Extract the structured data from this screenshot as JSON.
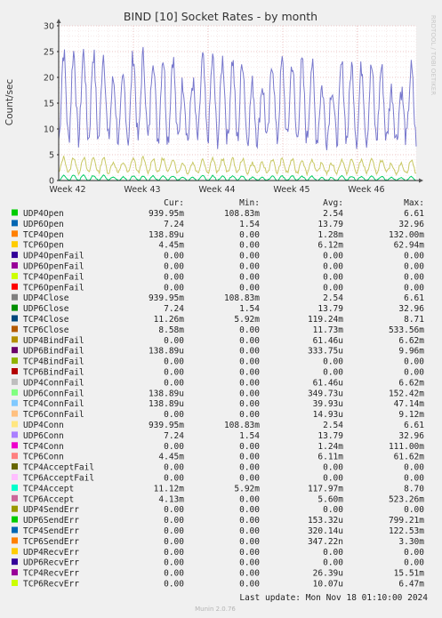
{
  "chart_data": {
    "type": "line",
    "title": "BIND [10] Socket Rates - by month",
    "ylabel": "Count/sec",
    "watermark": "RRDTOOL / TOBI OETIKER",
    "ylim": [
      0,
      30
    ],
    "y_ticks": [
      "0",
      "5",
      "10",
      "15",
      "20",
      "25",
      "30"
    ],
    "x_ticks": [
      "Week 42",
      "Week 43",
      "Week 44",
      "Week 45",
      "Week 46"
    ],
    "grid": true,
    "series_note": "Main visible series: UDP4Conn / UDP4Open (blue, daily oscillation ~10-25), TCP4Open/TCP4Conn (yellow-green, ~1.5-4.5), TCP4Accept (green, near 0).",
    "series_visible": [
      {
        "name": "UDP4Conn",
        "color": "#7777cc",
        "approx_daily_range": [
          8,
          25
        ]
      },
      {
        "name": "UDP6Open",
        "color": "#c8c864",
        "approx_daily_range": [
          1.5,
          4.5
        ]
      },
      {
        "name": "TCP4Accept",
        "color": "#00cc66",
        "approx_daily_range": [
          0,
          1
        ]
      }
    ]
  },
  "legend": {
    "headers": {
      "cur": "Cur:",
      "min": "Min:",
      "avg": "Avg:",
      "max": "Max:"
    },
    "rows": [
      {
        "name": "UDP4Open",
        "color": "#00cc00",
        "cur": "939.95m",
        "min": "108.83m",
        "avg": "2.54",
        "max": "6.61"
      },
      {
        "name": "UDP6Open",
        "color": "#0066b3",
        "cur": "7.24",
        "min": "1.54",
        "avg": "13.79",
        "max": "32.96"
      },
      {
        "name": "TCP4Open",
        "color": "#ff8000",
        "cur": "138.89u",
        "min": "0.00",
        "avg": "1.28m",
        "max": "132.00m"
      },
      {
        "name": "TCP6Open",
        "color": "#ffcc00",
        "cur": "4.45m",
        "min": "0.00",
        "avg": "6.12m",
        "max": "62.94m"
      },
      {
        "name": "UDP4OpenFail",
        "color": "#330099",
        "cur": "0.00",
        "min": "0.00",
        "avg": "0.00",
        "max": "0.00"
      },
      {
        "name": "UDP6OpenFail",
        "color": "#990099",
        "cur": "0.00",
        "min": "0.00",
        "avg": "0.00",
        "max": "0.00"
      },
      {
        "name": "TCP4OpenFail",
        "color": "#ccff00",
        "cur": "0.00",
        "min": "0.00",
        "avg": "0.00",
        "max": "0.00"
      },
      {
        "name": "TCP6OpenFail",
        "color": "#ff0000",
        "cur": "0.00",
        "min": "0.00",
        "avg": "0.00",
        "max": "0.00"
      },
      {
        "name": "UDP4Close",
        "color": "#808080",
        "cur": "939.95m",
        "min": "108.83m",
        "avg": "2.54",
        "max": "6.61"
      },
      {
        "name": "UDP6Close",
        "color": "#008f00",
        "cur": "7.24",
        "min": "1.54",
        "avg": "13.79",
        "max": "32.96"
      },
      {
        "name": "TCP4Close",
        "color": "#00487d",
        "cur": "11.26m",
        "min": "5.92m",
        "avg": "119.24m",
        "max": "8.71"
      },
      {
        "name": "TCP6Close",
        "color": "#b35a00",
        "cur": "8.58m",
        "min": "0.00",
        "avg": "11.73m",
        "max": "533.56m"
      },
      {
        "name": "UDP4BindFail",
        "color": "#b38f00",
        "cur": "0.00",
        "min": "0.00",
        "avg": "61.46u",
        "max": "6.62m"
      },
      {
        "name": "UDP6BindFail",
        "color": "#6b006b",
        "cur": "138.89u",
        "min": "0.00",
        "avg": "333.75u",
        "max": "9.96m"
      },
      {
        "name": "TCP4BindFail",
        "color": "#8fb300",
        "cur": "0.00",
        "min": "0.00",
        "avg": "0.00",
        "max": "0.00"
      },
      {
        "name": "TCP6BindFail",
        "color": "#b30000",
        "cur": "0.00",
        "min": "0.00",
        "avg": "0.00",
        "max": "0.00"
      },
      {
        "name": "UDP4ConnFail",
        "color": "#bebebe",
        "cur": "0.00",
        "min": "0.00",
        "avg": "61.46u",
        "max": "6.62m"
      },
      {
        "name": "UDP6ConnFail",
        "color": "#80ff80",
        "cur": "138.89u",
        "min": "0.00",
        "avg": "349.73u",
        "max": "152.42m"
      },
      {
        "name": "TCP4ConnFail",
        "color": "#80c9ff",
        "cur": "138.89u",
        "min": "0.00",
        "avg": "39.93u",
        "max": "47.14m"
      },
      {
        "name": "TCP6ConnFail",
        "color": "#ffc080",
        "cur": "0.00",
        "min": "0.00",
        "avg": "14.93u",
        "max": "9.12m"
      },
      {
        "name": "UDP4Conn",
        "color": "#ffe680",
        "cur": "939.95m",
        "min": "108.83m",
        "avg": "2.54",
        "max": "6.61"
      },
      {
        "name": "UDP6Conn",
        "color": "#aa80ff",
        "cur": "7.24",
        "min": "1.54",
        "avg": "13.79",
        "max": "32.96"
      },
      {
        "name": "TCP4Conn",
        "color": "#ee00cc",
        "cur": "0.00",
        "min": "0.00",
        "avg": "1.24m",
        "max": "111.00m"
      },
      {
        "name": "TCP6Conn",
        "color": "#ff8080",
        "cur": "4.45m",
        "min": "0.00",
        "avg": "6.11m",
        "max": "61.62m"
      },
      {
        "name": "TCP4AcceptFail",
        "color": "#666600",
        "cur": "0.00",
        "min": "0.00",
        "avg": "0.00",
        "max": "0.00"
      },
      {
        "name": "TCP6AcceptFail",
        "color": "#ffbfff",
        "cur": "0.00",
        "min": "0.00",
        "avg": "0.00",
        "max": "0.00"
      },
      {
        "name": "TCP4Accept",
        "color": "#00ffcc",
        "cur": "11.12m",
        "min": "5.92m",
        "avg": "117.97m",
        "max": "8.70"
      },
      {
        "name": "TCP6Accept",
        "color": "#cc6699",
        "cur": "4.13m",
        "min": "0.00",
        "avg": "5.60m",
        "max": "523.26m"
      },
      {
        "name": "UDP4SendErr",
        "color": "#999900",
        "cur": "0.00",
        "min": "0.00",
        "avg": "0.00",
        "max": "0.00"
      },
      {
        "name": "UDP6SendErr",
        "color": "#00cc00",
        "cur": "0.00",
        "min": "0.00",
        "avg": "153.32u",
        "max": "799.21m"
      },
      {
        "name": "TCP4SendErr",
        "color": "#0066b3",
        "cur": "0.00",
        "min": "0.00",
        "avg": "320.14u",
        "max": "122.53m"
      },
      {
        "name": "TCP6SendErr",
        "color": "#ff8000",
        "cur": "0.00",
        "min": "0.00",
        "avg": "347.22n",
        "max": "3.30m"
      },
      {
        "name": "UDP4RecvErr",
        "color": "#ffcc00",
        "cur": "0.00",
        "min": "0.00",
        "avg": "0.00",
        "max": "0.00"
      },
      {
        "name": "UDP6RecvErr",
        "color": "#330099",
        "cur": "0.00",
        "min": "0.00",
        "avg": "0.00",
        "max": "0.00"
      },
      {
        "name": "TCP4RecvErr",
        "color": "#990099",
        "cur": "0.00",
        "min": "0.00",
        "avg": "26.39u",
        "max": "15.51m"
      },
      {
        "name": "TCP6RecvErr",
        "color": "#ccff00",
        "cur": "0.00",
        "min": "0.00",
        "avg": "10.07u",
        "max": "6.47m"
      }
    ]
  },
  "footer": {
    "last_update": "Last update: Mon Nov 18 01:10:00 2024",
    "munin_version": "Munin 2.0.76"
  }
}
